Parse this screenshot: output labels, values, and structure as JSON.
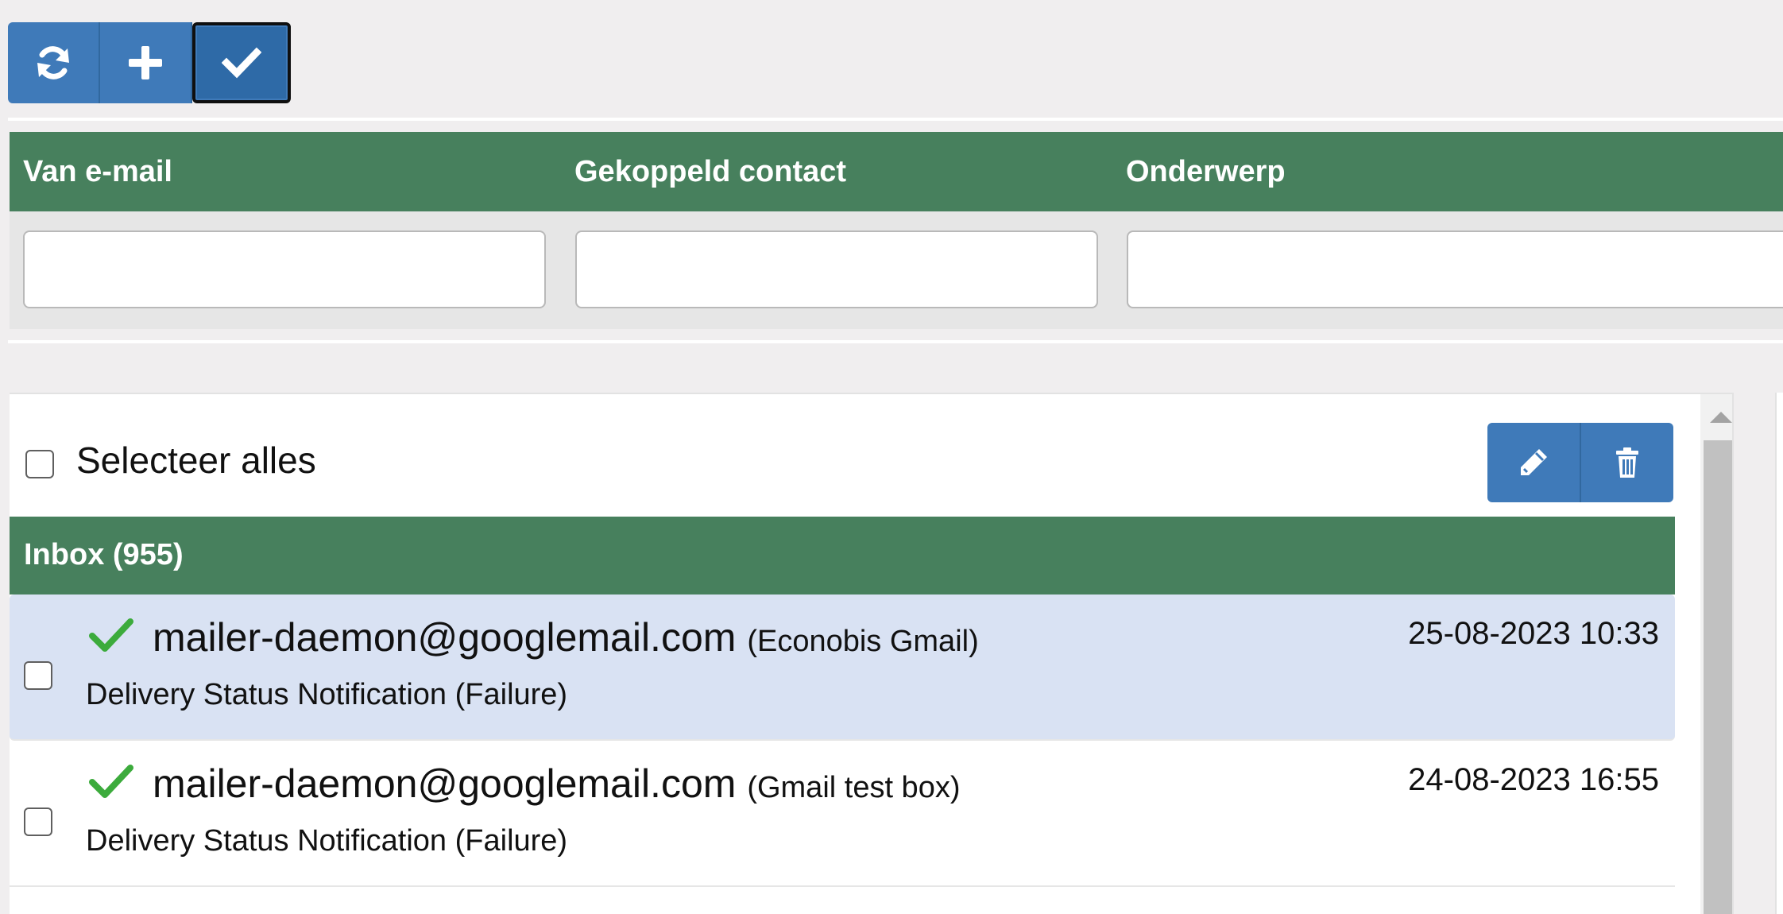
{
  "toolbar": {
    "buttons": [
      {
        "icon": "refresh-icon"
      },
      {
        "icon": "plus-icon"
      },
      {
        "icon": "check-icon",
        "active": true
      }
    ],
    "color": "#3f7ab9"
  },
  "filters": {
    "columns": [
      {
        "label": "Van e-mail",
        "value": ""
      },
      {
        "label": "Gekoppeld contact",
        "value": ""
      },
      {
        "label": "Onderwerp",
        "value": ""
      }
    ],
    "header_color": "#47805d"
  },
  "list": {
    "select_all_label": "Selecteer alles",
    "select_all_checked": false,
    "actions": [
      {
        "icon": "pencil-icon"
      },
      {
        "icon": "trash-icon"
      }
    ],
    "group_title": "Inbox (955)",
    "emails": [
      {
        "from": "mailer-daemon@googlemail.com",
        "account": "(Econobis Gmail)",
        "subject": "Delivery Status Notification (Failure)",
        "date": "25-08-2023 10:33",
        "status_icon": "check-icon",
        "selected": true,
        "checked": false
      },
      {
        "from": "mailer-daemon@googlemail.com",
        "account": "(Gmail test box)",
        "subject": "Delivery Status Notification (Failure)",
        "date": "24-08-2023 16:55",
        "status_icon": "check-icon",
        "selected": false,
        "checked": false
      }
    ],
    "selected_row_color": "#d9e2f3",
    "status_icon_color": "#3cab3c"
  }
}
